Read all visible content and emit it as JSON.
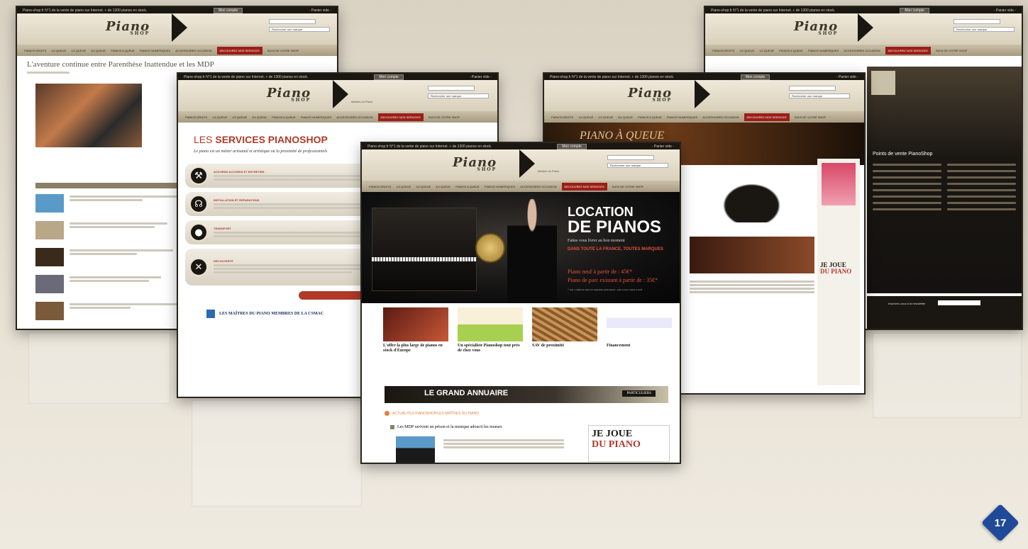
{
  "topbar_text": "Piano-shop.fr N°1 de la vente de piano sur Internet. + de 1300 pianos en stock.",
  "topbar_dropdown": "Mon compte",
  "topbar_cart": "- Panier vide -",
  "logo_text": "Piano",
  "logo_sub": "SHOP",
  "logo_tagline": "Maîtres du Piano",
  "brand_select": "Rechercher une marque",
  "nav": [
    "PIANOS DROITS",
    "1/4 QUEUE",
    "1/2 QUEUE",
    "3/4 QUEUE",
    "PIANOS A QUEUE",
    "PIANOS NUMERIQUES",
    "ACCESSOIRES OCCASION",
    "DECOUVREZ NOS SERVICES",
    "SUIVI DE VOTRE SHOP"
  ],
  "shot1": {
    "title": "L'aventure continue entre Parenthèse Inattendue et les MDP"
  },
  "shot2": {
    "title_light": "LES ",
    "title_bold": "SERVICES PIANOSHOP",
    "intro": "Le piano est un métier artisanal et artistique où la proximité de professionnels",
    "services": [
      "ACCORDS ACCORDS ET ENTRETIEN",
      "INSTALLATION ET REPARATIONS",
      "TRANSPORT",
      "DECOUVERTE"
    ],
    "footer": "LES MAÎTRES DU PIANO MEMBRES DE LA CSMAC"
  },
  "shot3": {
    "banner_title_1": "LOCATION",
    "banner_title_2": "DE PIANOS",
    "banner_sub": "Faites vous livrer au bon moment",
    "banner_red": "DANS TOUTE LA FRANCE, TOUTES MARQUES",
    "price_1": "Piano neuf à partir de : 45€*",
    "price_2": "Piano de parc existant à partir de : 35€*",
    "note": "* Voir conditions dans les magasins participants - plus à tout contrat locatif",
    "cards": [
      {
        "title": "L'offre la plus large de pianos en stock d'Europe"
      },
      {
        "title": "Un spécialiste Pianoshop tout près de chez vous"
      },
      {
        "title": "SAV de proximité"
      },
      {
        "title": "Financement"
      }
    ],
    "annuaire": "LE GRAND ANNUAIRE",
    "annuaire_sub": "PARTICULIERS",
    "news_heading": "ACTUALITES PIANOSHOP/LES MAÎTRES DU PIANO",
    "news_item": "Les MDP ravivent en prison et la musique adoucit les moeurs",
    "jejoue_1": "JE JOUE",
    "jejoue_2": "DU PIANO"
  },
  "shot4": {
    "banner": "PIANO À QUEUE"
  },
  "shot5": {
    "heading": "Points de vente PianoShop",
    "newsletter": "Inscrivez-vous à la newsletter"
  },
  "page_number": "17",
  "colors": {
    "accent": "#9c1e18",
    "dark": "#1a1712",
    "badge": "#1f4a9a"
  }
}
